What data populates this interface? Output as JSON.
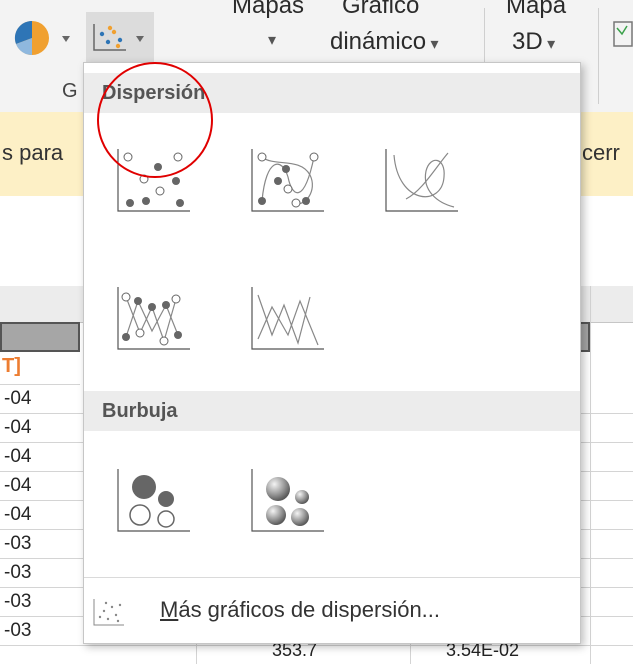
{
  "ribbon": {
    "mapas_label": "Mapas",
    "grafico_label": "Gráfico",
    "dinamico_label": "dinámico",
    "mapa_label": "Mapa",
    "mapa3d_label": "3D",
    "group_letter": "G"
  },
  "infobar": {
    "left_text": "s para",
    "right_text": "cerr"
  },
  "sheet": {
    "header_cell": "T]",
    "rows": [
      "-04",
      "-04",
      "-04",
      "-04",
      "-04",
      "-03",
      "-03",
      "-03",
      "-03"
    ],
    "bottom_values": [
      "353.7",
      "3.54E-02"
    ]
  },
  "dropdown": {
    "sections": [
      {
        "title": "Dispersión",
        "icons": [
          "scatter-markers-icon",
          "scatter-smooth-lines-markers-icon",
          "scatter-smooth-lines-icon",
          "scatter-straight-lines-markers-icon",
          "scatter-straight-lines-icon"
        ]
      },
      {
        "title": "Burbuja",
        "icons": [
          "bubble-icon",
          "bubble-3d-icon"
        ]
      }
    ],
    "more_label_accel": "M",
    "more_label_rest": "ás gráficos de dispersión...",
    "accent_color": "#e00000"
  }
}
